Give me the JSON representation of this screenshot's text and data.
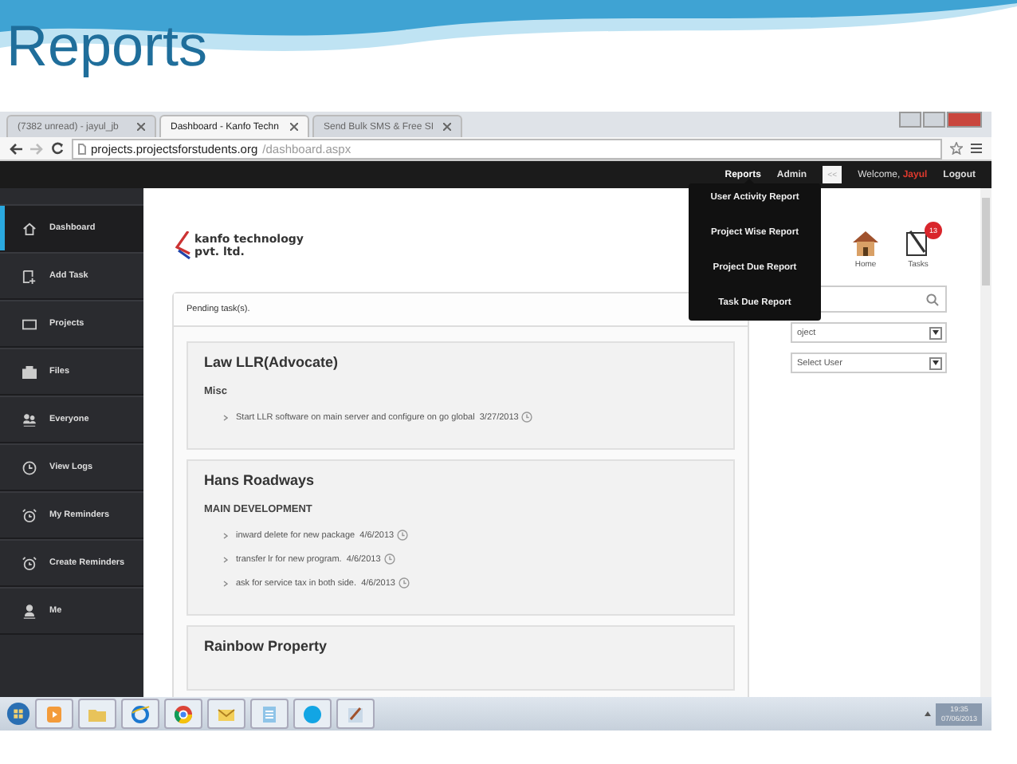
{
  "slide": {
    "title": "Reports"
  },
  "browser": {
    "tabs": [
      {
        "label": "(7382 unread) - jayul_jb",
        "selected": false
      },
      {
        "label": "Dashboard - Kanfo Techn",
        "selected": true
      },
      {
        "label": "Send Bulk SMS & Free SI",
        "selected": false
      }
    ],
    "address": {
      "host": "projects.projectsforstudents.org",
      "path": "/dashboard.aspx"
    }
  },
  "topbar": {
    "nav": [
      {
        "label": "Reports",
        "expanded": true
      },
      {
        "label": "Admin",
        "expanded": false
      }
    ],
    "collapse_button": "<<",
    "welcome": "Welcome,",
    "user": "Jayul",
    "logout": "Logout"
  },
  "reports_menu": [
    "User Activity Report",
    "Project Wise Report",
    "Project Due Report",
    "Task Due Report"
  ],
  "sidebar": {
    "items": [
      {
        "label": "Dashboard",
        "selected": true
      },
      {
        "label": "Add Task",
        "selected": false
      },
      {
        "label": "Projects",
        "selected": false
      },
      {
        "label": "Files",
        "selected": false
      },
      {
        "label": "Everyone",
        "selected": false
      },
      {
        "label": "View Logs",
        "selected": false
      },
      {
        "label": "My Reminders",
        "selected": false
      },
      {
        "label": "Create Reminders",
        "selected": false
      },
      {
        "label": "Me",
        "selected": false
      }
    ]
  },
  "logo": {
    "line1": "kanfo technology",
    "line2": "pvt. ltd."
  },
  "shortcuts": [
    {
      "label": "Home"
    },
    {
      "label": "Tasks",
      "badge": "13"
    }
  ],
  "filters": {
    "project_select": "oject",
    "user_select": "Select User"
  },
  "pending": {
    "title": "Pending task(s).",
    "projects": [
      {
        "name": "Law LLR(Advocate)",
        "groups": [
          {
            "name": "Misc",
            "tasks": [
              {
                "text": "Start LLR software on main server and configure on go global",
                "date": "3/27/2013"
              }
            ]
          }
        ]
      },
      {
        "name": "Hans Roadways",
        "groups": [
          {
            "name": "MAIN DEVELOPMENT",
            "tasks": [
              {
                "text": "inward delete for new package",
                "date": "4/6/2013"
              },
              {
                "text": "transfer lr for new program.",
                "date": "4/6/2013"
              },
              {
                "text": "ask for service tax in both side.",
                "date": "4/6/2013"
              }
            ]
          }
        ]
      },
      {
        "name": "Rainbow Property"
      }
    ]
  },
  "taskbar": {
    "time": "19:35",
    "date": "07/06/2013"
  }
}
